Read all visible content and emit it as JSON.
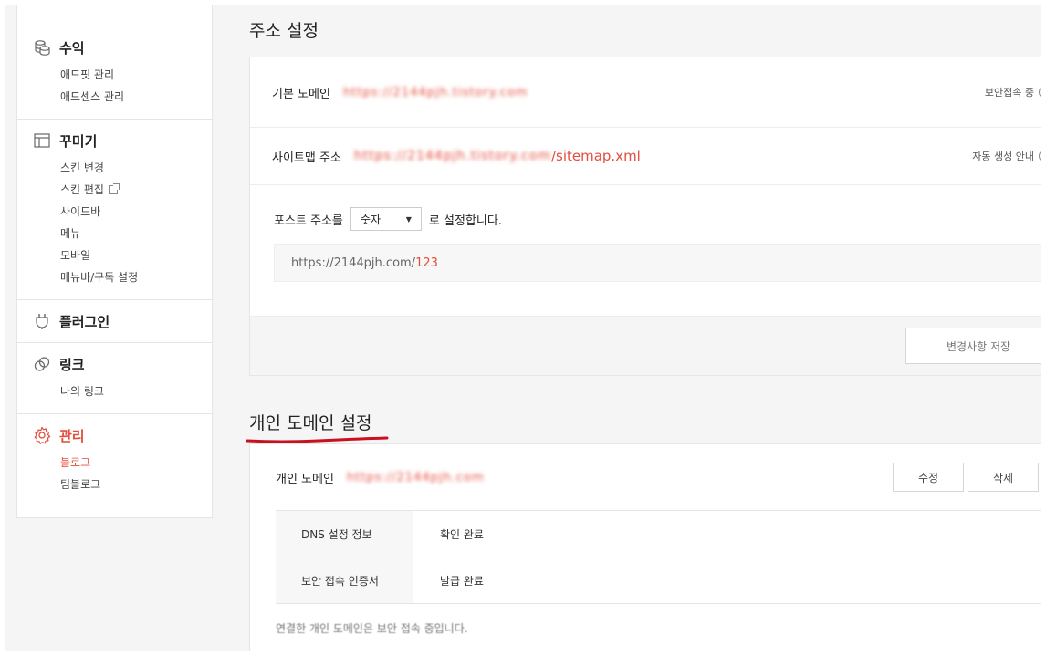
{
  "sidebar": {
    "groups": [
      {
        "icon": "coins-icon",
        "label": "수익",
        "items": [
          "애드핏 관리",
          "애드센스 관리"
        ]
      },
      {
        "icon": "layout-icon",
        "label": "꾸미기",
        "items": [
          "스킨 변경",
          "스킨 편집",
          "사이드바",
          "메뉴",
          "모바일",
          "메뉴바/구독 설정"
        ]
      },
      {
        "icon": "plug-icon",
        "label": "플러그인",
        "items": []
      },
      {
        "icon": "link-icon",
        "label": "링크",
        "items": [
          "나의 링크"
        ]
      },
      {
        "icon": "gear-icon",
        "label": "관리",
        "items": [
          "블로그",
          "팀블로그"
        ]
      }
    ]
  },
  "address": {
    "title": "주소 설정",
    "base_domain_label": "기본 도메인",
    "base_domain_value": "https://2144pjh.tistory.com",
    "secure_label": "보안접속 중",
    "sitemap_label": "사이트맵 주소",
    "sitemap_blurred": "https://2144pjh.tistory.com",
    "sitemap_suffix": "/sitemap.xml",
    "auto_label": "자동 생성 안내",
    "post_prefix": "포스트 주소를",
    "post_select": "숫자",
    "post_suffix": "로 설정합니다.",
    "preview_base": "https://2144pjh.com/",
    "preview_num": "123",
    "save_button": "변경사항 저장"
  },
  "custom_domain": {
    "title": "개인 도메인 설정",
    "label": "개인 도메인",
    "value": "https://2144pjh.com",
    "edit_button": "수정",
    "delete_button": "삭제",
    "rows": [
      {
        "key": "DNS 설정 정보",
        "value": "확인 완료"
      },
      {
        "key": "보안 접속 인증서",
        "value": "발급 완료"
      }
    ],
    "notice": "연결한 개인 도메인은 보안 접속 중입니다."
  },
  "colors": {
    "accent": "#e44c3c",
    "underline": "#c8101e"
  }
}
